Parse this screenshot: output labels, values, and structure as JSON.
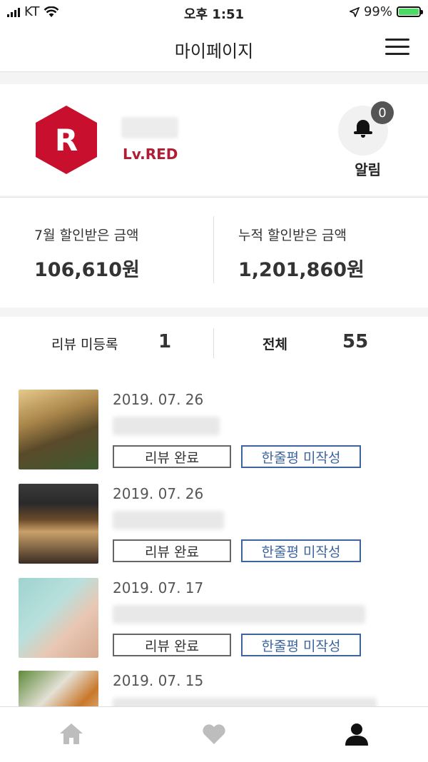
{
  "status_bar": {
    "carrier": "KT",
    "time": "오후 1:51",
    "battery": "99%",
    "battery_level": 0.99
  },
  "header": {
    "title": "마이페이지",
    "menu_icon": "hamburger-menu-icon"
  },
  "profile": {
    "avatar_letter": "R",
    "level": "Lv.RED",
    "notification_count": "0",
    "notification_label": "알림"
  },
  "discounts": {
    "monthly_label": "7월 할인받은 금액",
    "monthly_amount": "106,610원",
    "total_label": "누적 할인받은 금액",
    "total_amount": "1,201,860원"
  },
  "review_stats": {
    "unregistered_label": "리뷰 미등록",
    "unregistered_count": "1",
    "total_label": "전체",
    "total_count": "55"
  },
  "reviews": [
    {
      "date": "2019. 07. 26",
      "status": "리뷰 완료",
      "action": "한줄평 미작성"
    },
    {
      "date": "2019. 07. 26",
      "status": "리뷰 완료",
      "action": "한줄평 미작성"
    },
    {
      "date": "2019. 07. 17",
      "status": "리뷰 완료",
      "action": "한줄평 미작성"
    },
    {
      "date": "2019. 07. 15"
    }
  ],
  "colors": {
    "brand_red": "#c8102e",
    "accent_blue": "#3c64a0",
    "battery_green": "#4cd964"
  },
  "tabbar": {
    "icons": [
      "home-icon",
      "heart-icon",
      "person-icon"
    ]
  }
}
